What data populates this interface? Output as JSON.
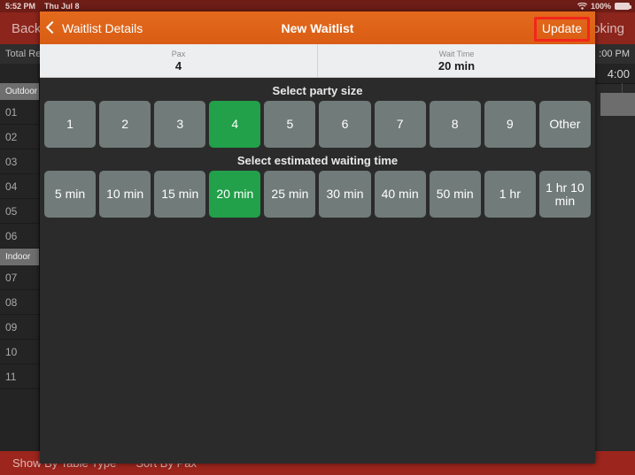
{
  "status_bar": {
    "time": "5:52 PM",
    "date": "Thu Jul 8",
    "battery_percent": "100%",
    "wifi_icon": "wifi-icon",
    "battery_icon": "battery-icon"
  },
  "background_app": {
    "nav": {
      "back_label": "Back",
      "right_label": "oking"
    },
    "subbar": {
      "total_label": "Total Re",
      "time_label": ":00 PM"
    },
    "timeline": {
      "time_label": "4:00"
    },
    "sidebar": {
      "groups": [
        {
          "label": "Outdoor",
          "tables": [
            "01",
            "02",
            "03",
            "04",
            "05",
            "06"
          ]
        },
        {
          "label": "Indoor",
          "tables": [
            "07",
            "08",
            "09",
            "10",
            "11"
          ]
        }
      ]
    },
    "bottom_bar": {
      "show_by": "Show By Table Type",
      "sort_by": "Sort By Pax"
    }
  },
  "modal": {
    "nav": {
      "back_label": "Waitlist Details",
      "back_chevron_icon": "chevron-left-icon",
      "title": "New Waitlist",
      "update_label": "Update",
      "highlight_color": "#f2261a",
      "bar_color": "#e2631a"
    },
    "summary": [
      {
        "label": "Pax",
        "value": "4"
      },
      {
        "label": "Wait Time",
        "value": "20 min"
      }
    ],
    "party_size": {
      "title": "Select party size",
      "options": [
        "1",
        "2",
        "3",
        "4",
        "5",
        "6",
        "7",
        "8",
        "9",
        "Other"
      ],
      "selected": "4",
      "selected_color": "#22a04a",
      "tile_color": "#717b79"
    },
    "waiting_time": {
      "title": "Select estimated waiting time",
      "options": [
        "5 min",
        "10 min",
        "15 min",
        "20 min",
        "25 min",
        "30 min",
        "40 min",
        "50 min",
        "1 hr",
        "1 hr\n10 min"
      ],
      "selected": "20 min",
      "selected_color": "#22a04a",
      "tile_color": "#717b79"
    }
  }
}
